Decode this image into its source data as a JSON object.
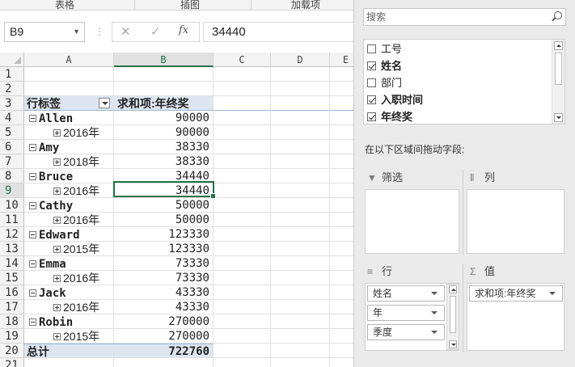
{
  "ribbon": {
    "groups": [
      "表格",
      "插图",
      "加载项"
    ]
  },
  "formula_bar": {
    "name_box": "B9",
    "value": "34440",
    "fx": "fx",
    "cancel": "✕",
    "enter": "✓"
  },
  "columns": [
    "A",
    "B",
    "C",
    "D",
    "E"
  ],
  "rows": [
    {
      "n": "1",
      "a": "",
      "b": "",
      "kind": "blank"
    },
    {
      "n": "2",
      "a": "",
      "b": "",
      "kind": "blank"
    },
    {
      "n": "3",
      "a": "行标签",
      "b": "求和项:年终奖",
      "kind": "header"
    },
    {
      "n": "4",
      "a": "Allen",
      "b": "90000",
      "kind": "group"
    },
    {
      "n": "5",
      "a": "2016年",
      "b": "90000",
      "kind": "child"
    },
    {
      "n": "6",
      "a": "Amy",
      "b": "38330",
      "kind": "group"
    },
    {
      "n": "7",
      "a": "2018年",
      "b": "38330",
      "kind": "child"
    },
    {
      "n": "8",
      "a": "Bruce",
      "b": "34440",
      "kind": "group"
    },
    {
      "n": "9",
      "a": "2016年",
      "b": "34440",
      "kind": "child"
    },
    {
      "n": "10",
      "a": "Cathy",
      "b": "50000",
      "kind": "group"
    },
    {
      "n": "11",
      "a": "2016年",
      "b": "50000",
      "kind": "child"
    },
    {
      "n": "12",
      "a": "Edward",
      "b": "123330",
      "kind": "group"
    },
    {
      "n": "13",
      "a": "2015年",
      "b": "123330",
      "kind": "child"
    },
    {
      "n": "14",
      "a": "Emma",
      "b": "73330",
      "kind": "group"
    },
    {
      "n": "15",
      "a": "2016年",
      "b": "73330",
      "kind": "child"
    },
    {
      "n": "16",
      "a": "Jack",
      "b": "43330",
      "kind": "group"
    },
    {
      "n": "17",
      "a": "2016年",
      "b": "43330",
      "kind": "child"
    },
    {
      "n": "18",
      "a": "Robin",
      "b": "270000",
      "kind": "group"
    },
    {
      "n": "19",
      "a": "2015年",
      "b": "270000",
      "kind": "child"
    },
    {
      "n": "20",
      "a": "总计",
      "b": "722760",
      "kind": "total"
    },
    {
      "n": "21",
      "a": "",
      "b": "",
      "kind": "blank"
    }
  ],
  "selected_cell": "B9",
  "pivot_pane": {
    "search_placeholder": "搜索",
    "fields": [
      {
        "label": "工号",
        "checked": false
      },
      {
        "label": "姓名",
        "checked": true
      },
      {
        "label": "部门",
        "checked": false
      },
      {
        "label": "入职时间",
        "checked": true
      },
      {
        "label": "年终奖",
        "checked": true
      }
    ],
    "instruction": "在以下区域间拖动字段:",
    "areas": {
      "filters": {
        "title": "筛选",
        "icon": "filter-icon"
      },
      "columns": {
        "title": "列",
        "icon": "columns-icon"
      },
      "rows": {
        "title": "行",
        "icon": "rows-icon",
        "items": [
          "姓名",
          "年",
          "季度"
        ]
      },
      "values": {
        "title": "值",
        "icon": "sigma-icon",
        "symbol": "Σ",
        "items": [
          "求和项:年终奖"
        ]
      }
    }
  }
}
